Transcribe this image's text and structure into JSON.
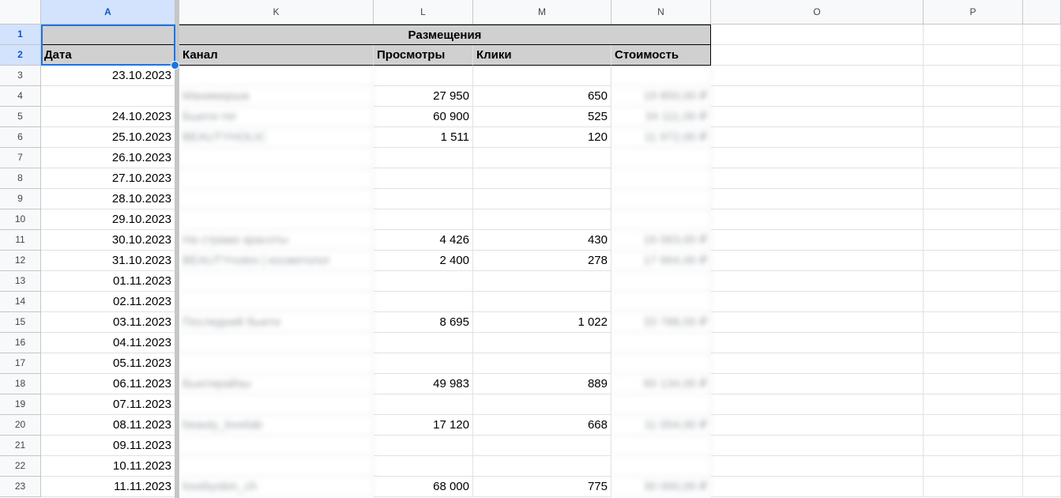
{
  "columns": [
    {
      "id": "A",
      "label": "A"
    },
    {
      "id": "K",
      "label": "K"
    },
    {
      "id": "L",
      "label": "L"
    },
    {
      "id": "M",
      "label": "M"
    },
    {
      "id": "N",
      "label": "N"
    },
    {
      "id": "O",
      "label": "O"
    },
    {
      "id": "P",
      "label": "P"
    }
  ],
  "header": {
    "date_label": "Дата",
    "group_label": "Размещения",
    "channel_label": "Канал",
    "views_label": "Просмотры",
    "clicks_label": "Клики",
    "cost_label": "Стоимость"
  },
  "rows": [
    {
      "n": "1"
    },
    {
      "n": "2"
    },
    {
      "n": "3",
      "date": "23.10.2023",
      "channel": "",
      "views": "",
      "clicks": "",
      "cost": ""
    },
    {
      "n": "4",
      "date": "",
      "channel": "Маникюрша",
      "views": "27 950",
      "clicks": "650",
      "cost": "19 850,00 ₽"
    },
    {
      "n": "5",
      "date": "24.10.2023",
      "channel": "Бьюти-тег",
      "views": "60 900",
      "clicks": "525",
      "cost": "34 111,00 ₽"
    },
    {
      "n": "6",
      "date": "25.10.2023",
      "channel": "BEAUTYHOLIC",
      "views": "1 511",
      "clicks": "120",
      "cost": "11 972,00 ₽"
    },
    {
      "n": "7",
      "date": "26.10.2023"
    },
    {
      "n": "8",
      "date": "27.10.2023"
    },
    {
      "n": "9",
      "date": "28.10.2023"
    },
    {
      "n": "10",
      "date": "29.10.2023"
    },
    {
      "n": "11",
      "date": "30.10.2023",
      "channel": "На страже красоты",
      "views": "4 426",
      "clicks": "430",
      "cost": "16 063,00 ₽"
    },
    {
      "n": "12",
      "date": "31.10.2023",
      "channel": "BEAUTYnotes | косметолог",
      "views": "2 400",
      "clicks": "278",
      "cost": "17 664,00 ₽"
    },
    {
      "n": "13",
      "date": "01.11.2023"
    },
    {
      "n": "14",
      "date": "02.11.2023"
    },
    {
      "n": "15",
      "date": "03.11.2023",
      "channel": "Последний бьюти",
      "views": "8 695",
      "clicks": "1 022",
      "cost": "33 788,00 ₽"
    },
    {
      "n": "16",
      "date": "04.11.2023"
    },
    {
      "n": "17",
      "date": "05.11.2023"
    },
    {
      "n": "18",
      "date": "06.11.2023",
      "channel": "Бьютирайзы",
      "views": "49 983",
      "clicks": "889",
      "cost": "60 134,00 ₽"
    },
    {
      "n": "19",
      "date": "07.11.2023"
    },
    {
      "n": "20",
      "date": "08.11.2023",
      "channel": "beauty_lovelab",
      "views": "17 120",
      "clicks": "668",
      "cost": "11 054,00 ₽"
    },
    {
      "n": "21",
      "date": "09.11.2023"
    },
    {
      "n": "22",
      "date": "10.11.2023"
    },
    {
      "n": "23",
      "date": "11.11.2023",
      "channel": "lovebyskin_ch",
      "views": "68 000",
      "clicks": "775",
      "cost": "30 000,00 ₽"
    }
  ]
}
